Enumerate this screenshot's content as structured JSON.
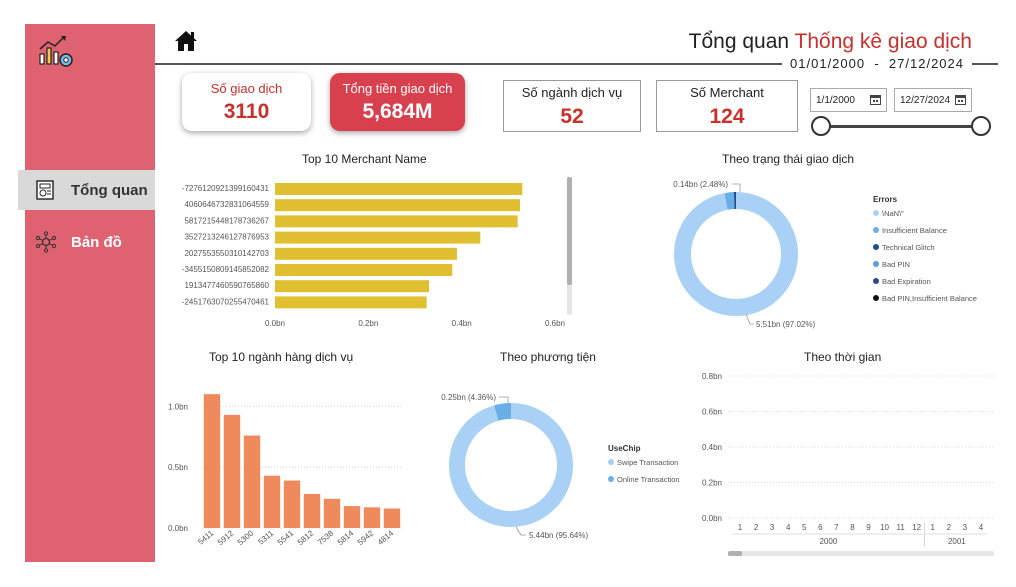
{
  "header": {
    "title_main": "Tổng quan ",
    "title_accent": "Thống kê giao dịch",
    "date_from": "01/01/2000",
    "date_sep": "-",
    "date_to": "27/12/2024"
  },
  "sidebar": {
    "items": [
      {
        "label": "Tổng quan",
        "icon": "dashboard-icon",
        "active": true
      },
      {
        "label": "Bản đồ",
        "icon": "network-map-icon",
        "active": false
      }
    ]
  },
  "kpis": [
    {
      "label": "Số giao dịch",
      "value": "3110"
    },
    {
      "label": "Tổng tiền giao dịch",
      "value": "5,684M"
    },
    {
      "label": "Số ngành dịch vụ",
      "value": "52"
    },
    {
      "label": "Số Merchant",
      "value": "124"
    }
  ],
  "date_filter": {
    "from": "1/1/2000",
    "to": "12/27/2024"
  },
  "colors": {
    "sidebar": "#de6270",
    "accent_red": "#c9302c",
    "bar_yellow": "#e0c030",
    "bar_orange": "#ee8a5c",
    "donut_light": "#a9d1f5",
    "donut_mid": "#6aaee8",
    "donut_dark": "#1f4e8c"
  },
  "chart_data": [
    {
      "type": "bar",
      "orientation": "horizontal",
      "title": "Top 10 Merchant Name",
      "categories": [
        "-7276120921399160431",
        "4060646732831064559",
        "5817215448178736267",
        "3527213246127876953",
        "2027553550310142703",
        "-3455150809145852082",
        "1913477460590765860",
        "-2451763070255470461"
      ],
      "values": [
        0.53,
        0.525,
        0.52,
        0.44,
        0.39,
        0.38,
        0.33,
        0.325
      ],
      "xticks": [
        "0.0bn",
        "0.2bn",
        "0.4bn",
        "0.6bn"
      ],
      "xlim": [
        0,
        0.6
      ]
    },
    {
      "type": "pie",
      "subtype": "donut",
      "title": "Theo trạng thái giao dịch",
      "legend_title": "Errors",
      "legend": [
        "\\NaN\\\"",
        "Insufficient Balance",
        "Technical Glitch",
        "Bad PIN",
        "Bad Expiration",
        "Bad PIN,Insufficient Balance"
      ],
      "legend_colors": [
        "#a9d1f5",
        "#6aaee8",
        "#1f4e8c",
        "#5a9ee0",
        "#2b4a8c",
        "#111111"
      ],
      "slices": [
        {
          "label": "\\NaN\\\"",
          "value": 5.51,
          "text": "5.51bn (97.02%)"
        },
        {
          "label": "Insufficient Balance",
          "value": 0.14,
          "text": "0.14bn (2.48%)"
        },
        {
          "label": "Technical Glitch",
          "value": 0.03,
          "text": ""
        }
      ]
    },
    {
      "type": "bar",
      "title": "Top 10 ngành hàng dịch vụ",
      "categories": [
        "5411",
        "5912",
        "5300",
        "5311",
        "5541",
        "5812",
        "7538",
        "5814",
        "5942",
        "4814"
      ],
      "values": [
        1.1,
        0.93,
        0.76,
        0.43,
        0.39,
        0.28,
        0.24,
        0.18,
        0.17,
        0.16
      ],
      "yticks": [
        "0.0bn",
        "0.5bn",
        "1.0bn"
      ],
      "ylim": [
        0,
        1.2
      ]
    },
    {
      "type": "pie",
      "subtype": "donut",
      "title": "Theo phương tiện",
      "legend_title": "UseChip",
      "legend": [
        "Swipe Transaction",
        "Online Transaction"
      ],
      "legend_colors": [
        "#a9d1f5",
        "#6aaee8"
      ],
      "slices": [
        {
          "label": "Swipe Transaction",
          "value": 5.44,
          "text": "5.44bn (95.64%)"
        },
        {
          "label": "Online Transaction",
          "value": 0.25,
          "text": "0.25bn (4.36%)"
        }
      ]
    },
    {
      "type": "line",
      "title": "Theo thời gian",
      "yticks": [
        "0.8bn",
        "0.6bn",
        "0.4bn",
        "0.2bn",
        "0.0bn"
      ],
      "ylim": [
        0,
        0.8
      ],
      "x": [
        "1",
        "2",
        "3",
        "4",
        "5",
        "6",
        "7",
        "8",
        "9",
        "10",
        "11",
        "12",
        "1",
        "2",
        "3",
        "4"
      ],
      "x_groups": [
        {
          "label": "2000",
          "count": 12
        },
        {
          "label": "2001",
          "count": 4
        }
      ],
      "series": []
    }
  ]
}
